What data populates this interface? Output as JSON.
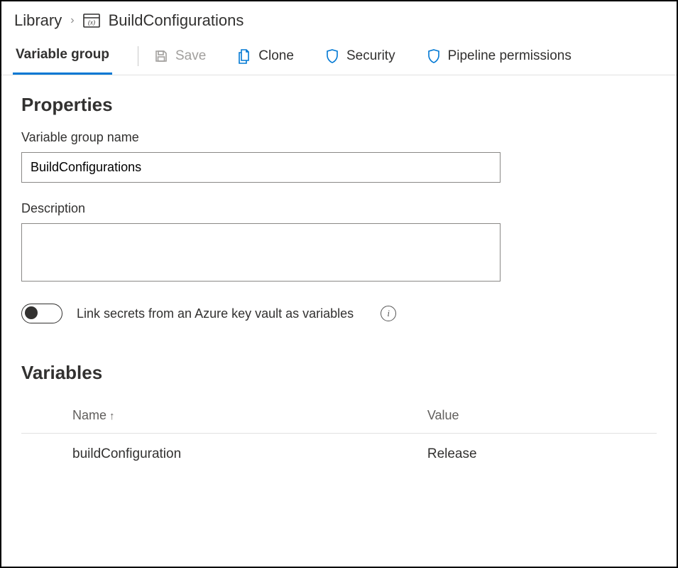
{
  "breadcrumb": {
    "root": "Library",
    "current": "BuildConfigurations"
  },
  "toolbar": {
    "tab_label": "Variable group",
    "save_label": "Save",
    "clone_label": "Clone",
    "security_label": "Security",
    "pipeline_perms_label": "Pipeline permissions"
  },
  "properties": {
    "heading": "Properties",
    "name_label": "Variable group name",
    "name_value": "BuildConfigurations",
    "description_label": "Description",
    "description_value": "",
    "link_secrets_label": "Link secrets from an Azure key vault as variables",
    "link_secrets_on": false
  },
  "variables": {
    "heading": "Variables",
    "columns": {
      "name": "Name",
      "value": "Value"
    },
    "rows": [
      {
        "name": "buildConfiguration",
        "value": "Release"
      }
    ]
  }
}
